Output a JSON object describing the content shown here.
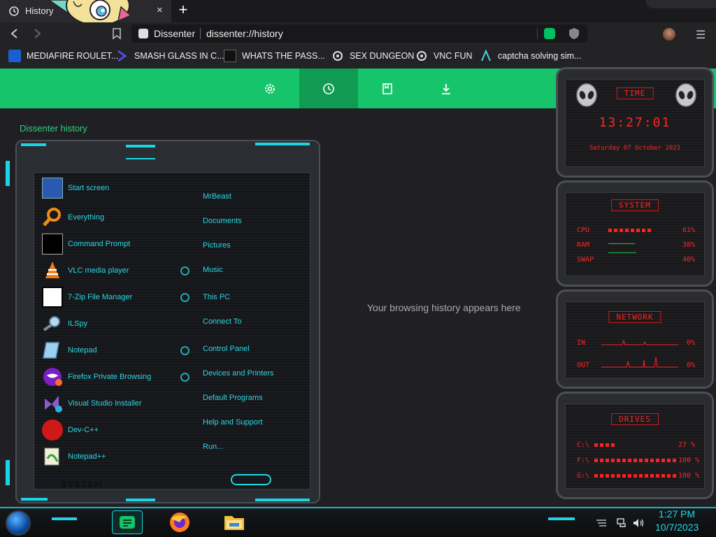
{
  "browser": {
    "tab_title": "History",
    "tab_close": "×",
    "new_tab": "+",
    "site_name": "Dissenter",
    "url": "dissenter://history",
    "menu": "☰"
  },
  "bookmarks": [
    {
      "label": "MEDIAFIRE ROULET...",
      "icon": "mediafire-icon"
    },
    {
      "label": "SMASH GLASS IN C...",
      "icon": "chevron-logo-icon"
    },
    {
      "label": "WHATS THE PASS...",
      "icon": "terminal-icon"
    },
    {
      "label": "SEX DUNGEON",
      "icon": "gear-person-icon"
    },
    {
      "label": "VNC FUN",
      "icon": "gear-person-icon"
    },
    {
      "label": "captcha solving sim...",
      "icon": "lambda-icon"
    }
  ],
  "page": {
    "title": "Dissenter history",
    "empty_message": "Your browsing history appears here"
  },
  "start_menu": {
    "apps": [
      {
        "label": "Start screen",
        "icon": "start-screen-icon"
      },
      {
        "label": "Everything",
        "icon": "magnifier-icon"
      },
      {
        "label": "Command Prompt",
        "icon": "cmd-icon"
      },
      {
        "label": "VLC media player",
        "icon": "vlc-icon"
      },
      {
        "label": "7-Zip File Manager",
        "icon": "7zip-icon"
      },
      {
        "label": "ILSpy",
        "icon": "ilspy-icon"
      },
      {
        "label": "Notepad",
        "icon": "notepad-icon"
      },
      {
        "label": "Firefox Private Browsing",
        "icon": "firefox-private-icon"
      },
      {
        "label": "Visual Studio Installer",
        "icon": "vs-installer-icon"
      },
      {
        "label": "Dev-C++",
        "icon": "devcpp-icon"
      },
      {
        "label": "Notepad++",
        "icon": "notepadpp-icon"
      }
    ],
    "places": [
      {
        "label": "MrBeast",
        "dot": false
      },
      {
        "label": "Documents",
        "dot": false
      },
      {
        "label": "Pictures",
        "dot": false
      },
      {
        "label": "Music",
        "dot": true
      },
      {
        "label": "This PC",
        "dot": true
      },
      {
        "label": "Connect To",
        "dot": false
      },
      {
        "label": "Control Panel",
        "dot": true
      },
      {
        "label": "Devices and Printers",
        "dot": true
      },
      {
        "label": "Default Programs",
        "dot": false
      },
      {
        "label": "Help and Support",
        "dot": false
      },
      {
        "label": "Run...",
        "dot": false
      }
    ],
    "footer_label": "SYSTEM"
  },
  "gadgets": {
    "time": {
      "header": "TIME",
      "clock": "13:27:01",
      "date": "Saturday 07 October 2023"
    },
    "system": {
      "header": "SYSTEM",
      "rows": [
        {
          "label": "CPU",
          "value": "61%",
          "level": 0.61
        },
        {
          "label": "RAM",
          "value": "38%",
          "level": 0.38
        },
        {
          "label": "SWAP",
          "value": "40%",
          "level": 0.4
        }
      ]
    },
    "network": {
      "header": "NETWORK",
      "in_label": "IN",
      "in_value": "0%",
      "out_label": "OUT",
      "out_value": "0%"
    },
    "drives": {
      "header": "DRIVES",
      "rows": [
        {
          "label": "C:\\",
          "value": "27 %"
        },
        {
          "label": "F:\\",
          "value": "100 %"
        },
        {
          "label": "G:\\",
          "value": "100 %"
        }
      ]
    }
  },
  "taskbar": {
    "time": "1:27 PM",
    "date": "10/7/2023"
  },
  "colors": {
    "accent_green": "#16c46b",
    "start_menu_text": "#29d7e3",
    "gadget_red": "#ff2424",
    "clock_cyan": "#20d8e4"
  }
}
